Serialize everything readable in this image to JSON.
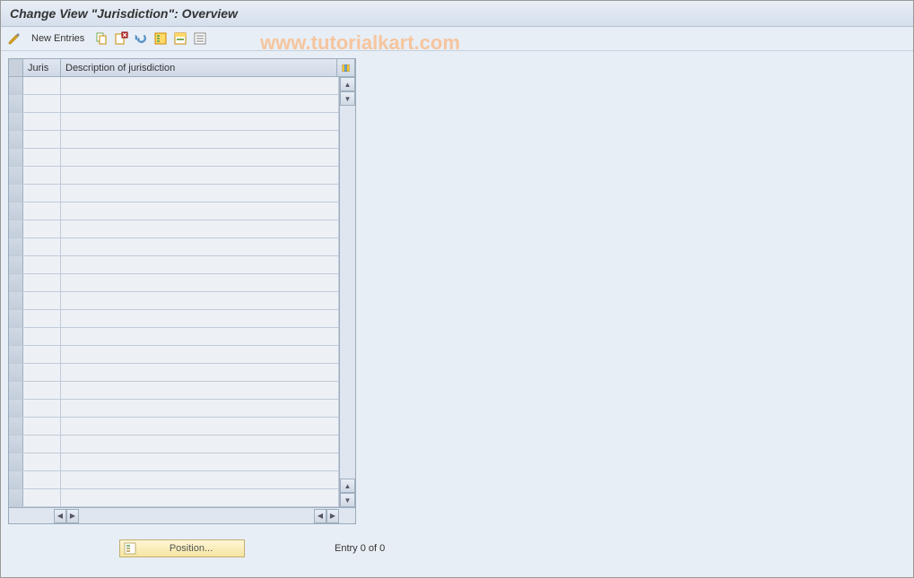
{
  "title": "Change View \"Jurisdiction\": Overview",
  "watermark": "www.tutorialkart.com",
  "toolbar": {
    "new_entries_label": "New Entries"
  },
  "table": {
    "columns": {
      "juris": "Juris",
      "desc": "Description of jurisdiction"
    },
    "rows": [
      {
        "juris": "",
        "desc": ""
      },
      {
        "juris": "",
        "desc": ""
      },
      {
        "juris": "",
        "desc": ""
      },
      {
        "juris": "",
        "desc": ""
      },
      {
        "juris": "",
        "desc": ""
      },
      {
        "juris": "",
        "desc": ""
      },
      {
        "juris": "",
        "desc": ""
      },
      {
        "juris": "",
        "desc": ""
      },
      {
        "juris": "",
        "desc": ""
      },
      {
        "juris": "",
        "desc": ""
      },
      {
        "juris": "",
        "desc": ""
      },
      {
        "juris": "",
        "desc": ""
      },
      {
        "juris": "",
        "desc": ""
      },
      {
        "juris": "",
        "desc": ""
      },
      {
        "juris": "",
        "desc": ""
      },
      {
        "juris": "",
        "desc": ""
      },
      {
        "juris": "",
        "desc": ""
      },
      {
        "juris": "",
        "desc": ""
      },
      {
        "juris": "",
        "desc": ""
      },
      {
        "juris": "",
        "desc": ""
      },
      {
        "juris": "",
        "desc": ""
      },
      {
        "juris": "",
        "desc": ""
      },
      {
        "juris": "",
        "desc": ""
      },
      {
        "juris": "",
        "desc": ""
      }
    ]
  },
  "footer": {
    "position_label": "Position...",
    "entry_status": "Entry 0 of 0"
  },
  "icons": {
    "change": "change-icon",
    "copy": "copy-icon",
    "delete": "delete-icon",
    "undo": "undo-icon",
    "select_all": "select-all-icon",
    "select_block": "select-block-icon",
    "deselect_all": "deselect-all-icon",
    "config": "config-columns-icon"
  }
}
